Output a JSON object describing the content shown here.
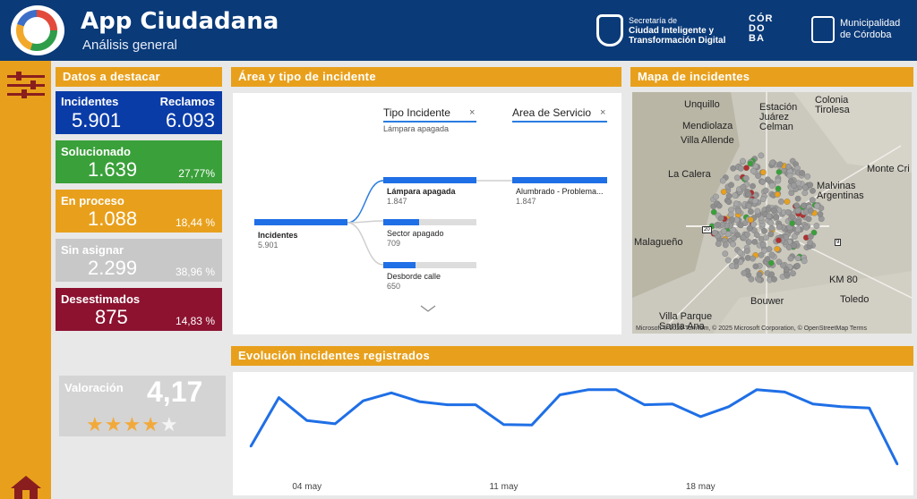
{
  "header": {
    "title": "App Ciudadana",
    "subtitle": "Análisis general",
    "brand1_line1": "Secretaría de",
    "brand1_line2": "Ciudad Inteligente y",
    "brand1_line3": "Transformación Digital",
    "cordoba": "CÓR DO BA",
    "muni_line1": "Municipalidad",
    "muni_line2": "de Córdoba"
  },
  "sections": {
    "destacar": "Datos a destacar",
    "area": "Área y tipo de incidente",
    "mapa": "Mapa de incidentes",
    "evolucion": "Evolución incidentes registrados"
  },
  "kpis": {
    "incidentes_label": "Incidentes",
    "incidentes_value": "5.901",
    "reclamos_label": "Reclamos",
    "reclamos_value": "6.093",
    "solucionado_label": "Solucionado",
    "solucionado_value": "1.639",
    "solucionado_pct": "27,77%",
    "proceso_label": "En proceso",
    "proceso_value": "1.088",
    "proceso_pct": "18,44 %",
    "sin_asignar_label": "Sin asignar",
    "sin_asignar_value": "2.299",
    "sin_asignar_pct": "38,96 %",
    "desestimados_label": "Desestimados",
    "desestimados_value": "875",
    "desestimados_pct": "14,83 %"
  },
  "rating": {
    "label": "Valoración",
    "value": "4,17",
    "stars": 4.17,
    "max": 5
  },
  "tree": {
    "filter1": "Tipo Incidente",
    "filter1_value": "Lámpara apagada",
    "filter2": "Area de Servicio",
    "root_label": "Incidentes",
    "root_value": "5.901",
    "nodes": [
      {
        "label": "Lámpara apagada",
        "value": "1.847",
        "fraction": 1.0
      },
      {
        "label": "Sector apagado",
        "value": "709",
        "fraction": 0.38
      },
      {
        "label": "Desborde calle",
        "value": "650",
        "fraction": 0.35
      }
    ],
    "leaf_label": "Alumbrado - Problema...",
    "leaf_value": "1.847",
    "close": "×"
  },
  "map": {
    "places": [
      "Unquillo",
      "Estación Juárez Celman",
      "Colonia Tirolesa",
      "Mendiolaza",
      "Villa Allende",
      "La Calera",
      "Monte Cri",
      "Malvinas Argentinas",
      "Malagueño",
      "KM 80",
      "Bouwer",
      "Toledo",
      "Villa Parque Santa Ana"
    ],
    "attribution": "Microsoft © 2025 TomTom, © 2025 Microsoft Corporation, © OpenStreetMap  Terms",
    "route_badges": [
      "20",
      "9"
    ]
  },
  "chart_data": {
    "type": "line",
    "title": "Evolución incidentes registrados",
    "x_tick_labels": [
      "04 may",
      "11 may",
      "18 may"
    ],
    "x_tick_indices": [
      2,
      9,
      16
    ],
    "values": [
      215,
      338,
      280,
      272,
      330,
      350,
      328,
      320,
      320,
      270,
      269,
      345,
      358,
      358,
      320,
      322,
      290,
      315,
      358,
      352,
      322,
      315,
      312,
      170
    ],
    "ylim": [
      150,
      380
    ],
    "series_color": "#1f6fe6"
  },
  "colors": {
    "header": "#0a3a78",
    "accent": "#e8a01c",
    "blue": "#0a3ca8",
    "green": "#3aa03a",
    "orange": "#e8a01c",
    "grey": "#c8c8c8",
    "red": "#8c1230"
  }
}
